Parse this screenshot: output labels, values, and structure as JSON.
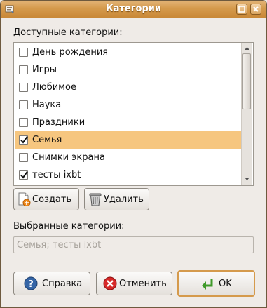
{
  "window": {
    "title": "Категории",
    "controls": [
      "maximize-icon",
      "close-icon"
    ]
  },
  "available_label": "Доступные категории:",
  "categories": [
    {
      "label": "День рождения",
      "checked": false,
      "selected": false
    },
    {
      "label": "Игры",
      "checked": false,
      "selected": false
    },
    {
      "label": "Любимое",
      "checked": false,
      "selected": false
    },
    {
      "label": "Наука",
      "checked": false,
      "selected": false
    },
    {
      "label": "Праздники",
      "checked": false,
      "selected": false
    },
    {
      "label": "Семья",
      "checked": true,
      "selected": true
    },
    {
      "label": "Снимки экрана",
      "checked": false,
      "selected": false
    },
    {
      "label": "тесты ixbt",
      "checked": true,
      "selected": false
    }
  ],
  "actions": {
    "create_label": "Создать",
    "delete_label": "Удалить"
  },
  "selected_label": "Выбранные категории:",
  "selected_value": "Семья; тесты ixbt",
  "footer": {
    "help_label": "Справка",
    "cancel_label": "Отменить",
    "ok_label": "OK"
  },
  "colors": {
    "titlebar": "#d59a4c",
    "selection": "#f6c67f",
    "default_button_border": "#d59a4c"
  }
}
